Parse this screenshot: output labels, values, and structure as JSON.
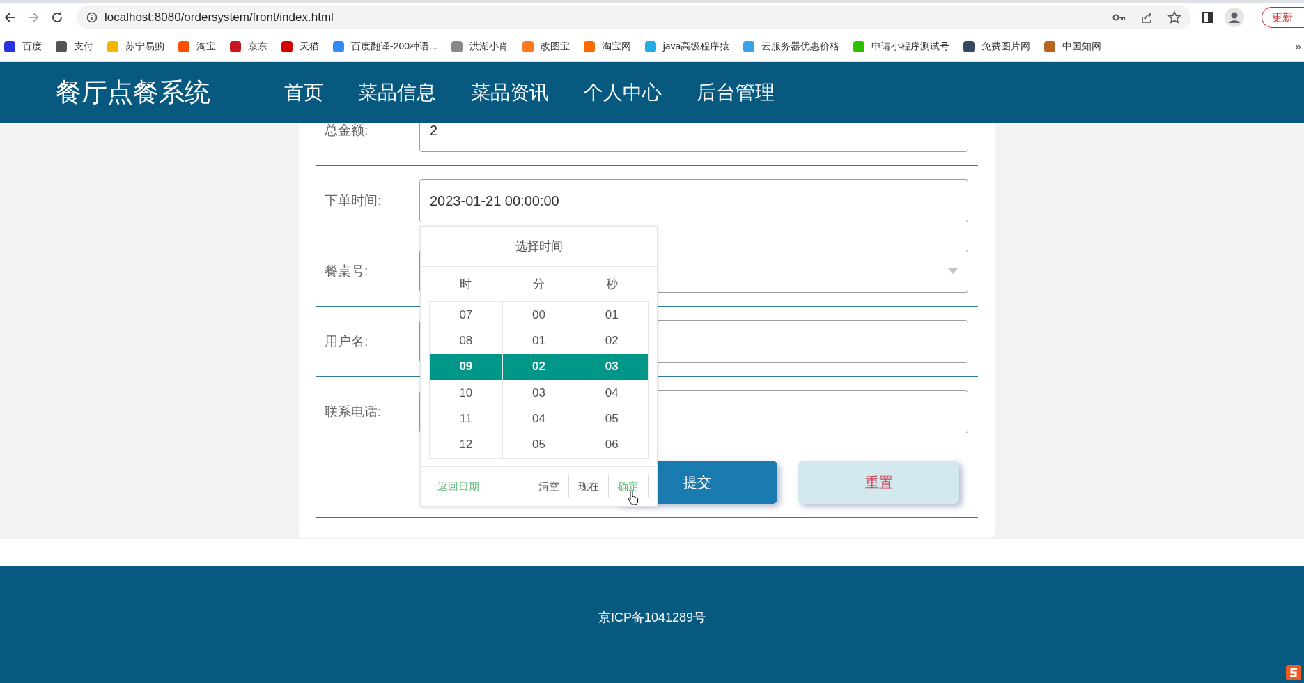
{
  "browser": {
    "url": "localhost:8080/ordersystem/front/index.html",
    "update_button": "更新",
    "bookmarks": [
      {
        "label": "百度",
        "color": "#2932e1"
      },
      {
        "label": "支付",
        "color": "#555555"
      },
      {
        "label": "苏宁易购",
        "color": "#f5b400"
      },
      {
        "label": "淘宝",
        "color": "#ff5000"
      },
      {
        "label": "京东",
        "color": "#c81623"
      },
      {
        "label": "天猫",
        "color": "#d40000"
      },
      {
        "label": "百度翻译-200种语...",
        "color": "#2f8cf5"
      },
      {
        "label": "洪湖小肖",
        "color": "#888888"
      },
      {
        "label": "改图宝",
        "color": "#ff7a1a"
      },
      {
        "label": "淘宝网",
        "color": "#ff6a00"
      },
      {
        "label": "java高级程序猿",
        "color": "#23ade5"
      },
      {
        "label": "云服务器优惠价格",
        "color": "#3ca0e6"
      },
      {
        "label": "申请小程序测试号",
        "color": "#2dc100"
      },
      {
        "label": "免费图片网",
        "color": "#34495e"
      },
      {
        "label": "中国知网",
        "color": "#b5651d"
      }
    ],
    "overflow": "»"
  },
  "site": {
    "logo": "餐厅点餐系统",
    "nav": [
      {
        "label": "首页"
      },
      {
        "label": "菜品信息"
      },
      {
        "label": "菜品资讯"
      },
      {
        "label": "个人中心"
      },
      {
        "label": "后台管理"
      }
    ]
  },
  "form": {
    "fields": [
      {
        "label": "总金额:",
        "value": "2",
        "kind": "text"
      },
      {
        "label": "下单时间:",
        "value": "2023-01-21 00:00:00",
        "kind": "text"
      },
      {
        "label": "餐桌号:",
        "kind": "select"
      },
      {
        "label": "用户名:",
        "kind": "text"
      },
      {
        "label": "联系电话:",
        "kind": "text"
      }
    ],
    "actions": [
      {
        "label": "提交",
        "kind": "submit"
      },
      {
        "label": "重置",
        "kind": "reset"
      }
    ]
  },
  "time_picker": {
    "title": "选择时间",
    "columns": [
      {
        "header": "时",
        "items": [
          {
            "label": "07",
            "selected": false
          },
          {
            "label": "08",
            "selected": false
          },
          {
            "label": "09",
            "selected": true
          },
          {
            "label": "10",
            "selected": false
          },
          {
            "label": "11",
            "selected": false
          },
          {
            "label": "12",
            "selected": false
          }
        ]
      },
      {
        "header": "分",
        "items": [
          {
            "label": "00",
            "selected": false
          },
          {
            "label": "01",
            "selected": false
          },
          {
            "label": "02",
            "selected": true
          },
          {
            "label": "03",
            "selected": false
          },
          {
            "label": "04",
            "selected": false
          },
          {
            "label": "05",
            "selected": false
          }
        ]
      },
      {
        "header": "秒",
        "items": [
          {
            "label": "01",
            "selected": false
          },
          {
            "label": "02",
            "selected": false
          },
          {
            "label": "03",
            "selected": true
          },
          {
            "label": "04",
            "selected": false
          },
          {
            "label": "05",
            "selected": false
          },
          {
            "label": "06",
            "selected": false
          }
        ]
      }
    ],
    "back_link": "返回日期",
    "buttons": [
      {
        "label": "清空",
        "kind": "default"
      },
      {
        "label": "现在",
        "kind": "default"
      },
      {
        "label": "确定",
        "kind": "confirm"
      }
    ]
  },
  "footer": {
    "text": "京ICP备1041289号"
  }
}
